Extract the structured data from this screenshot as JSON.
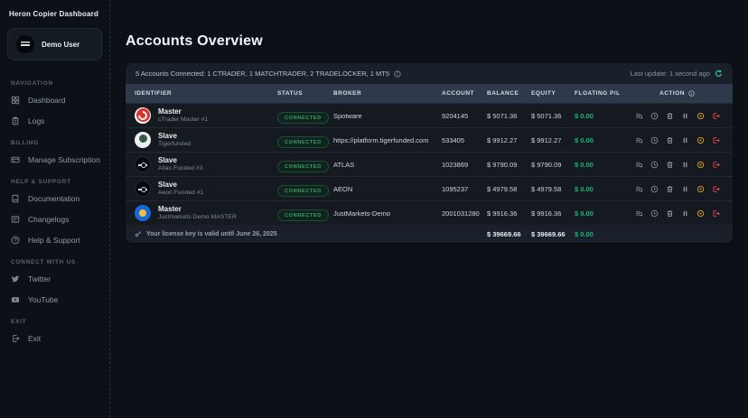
{
  "app": {
    "title": "Heron Copier Dashboard"
  },
  "sidebar": {
    "user": {
      "name": "Demo User"
    },
    "sections": {
      "navigation": {
        "label": "Navigation",
        "dashboard": "Dashboard",
        "logs": "Logs"
      },
      "billing": {
        "label": "Billing",
        "manage_subscription": "Manage Subscription"
      },
      "help": {
        "label": "Help & Support",
        "documentation": "Documentation",
        "changelogs": "Changelogs",
        "help_support": "Help & Support"
      },
      "connect": {
        "label": "Connect With Us",
        "twitter": "Twitter",
        "youtube": "YouTube"
      },
      "exit": {
        "label": "Exit",
        "exit": "Exit"
      }
    }
  },
  "main": {
    "title": "Accounts Overview",
    "summary": "5 Accounts Connected: 1 CTRADER, 1 MATCHTRADER, 2 TRADELOCKER, 1 MT5",
    "last_update": "Last update: 1 second ago",
    "table": {
      "headers": {
        "identifier": "Identifier",
        "status": "Status",
        "broker": "Broker",
        "account": "Account",
        "balance": "Balance",
        "equity": "Equity",
        "floating": "Floating P/L",
        "action": "Action"
      },
      "rows": [
        {
          "role": "Master",
          "name": "cTrader Master #1",
          "status": "CONNECTED",
          "broker": "Spotware",
          "account": "9204145",
          "balance": "$ 5071.36",
          "equity": "$ 5071.36",
          "floating": "$ 0.00",
          "avatar": "ctrader"
        },
        {
          "role": "Slave",
          "name": "Tigerfunded",
          "status": "CONNECTED",
          "broker": "https://platform.tigerfunded.com",
          "account": "533405",
          "balance": "$ 9912.27",
          "equity": "$ 9912.27",
          "floating": "$ 0.00",
          "avatar": "tiger"
        },
        {
          "role": "Slave",
          "name": "Atlas Funded #3",
          "status": "CONNECTED",
          "broker": "ATLAS",
          "account": "1023869",
          "balance": "$ 9790.09",
          "equity": "$ 9790.09",
          "floating": "$ 0.00",
          "avatar": "atlas"
        },
        {
          "role": "Slave",
          "name": "Aeon Funded #1",
          "status": "CONNECTED",
          "broker": "AEON",
          "account": "1095237",
          "balance": "$ 4979.58",
          "equity": "$ 4979.58",
          "floating": "$ 0.00",
          "avatar": "aeon"
        },
        {
          "role": "Master",
          "name": "Justmarkets Demo MASTER",
          "status": "CONNECTED",
          "broker": "JustMarkets-Demo",
          "account": "2001031280",
          "balance": "$ 9916.36",
          "equity": "$ 9916.36",
          "floating": "$ 0.00",
          "avatar": "justmarkets"
        }
      ],
      "footer": {
        "license": "Your license key is valid until June 26, 2025",
        "total_balance": "$ 39669.66",
        "total_equity": "$ 39669.66",
        "total_floating": "$ 0.00"
      }
    },
    "colors": {
      "accent_green": "#2ee6a8",
      "positive_green": "#17b877",
      "status_connected": "#38a06c",
      "warning_amber": "#d29922",
      "danger_red": "#e5484d",
      "table_header_bg": "#2e3a4b"
    }
  }
}
